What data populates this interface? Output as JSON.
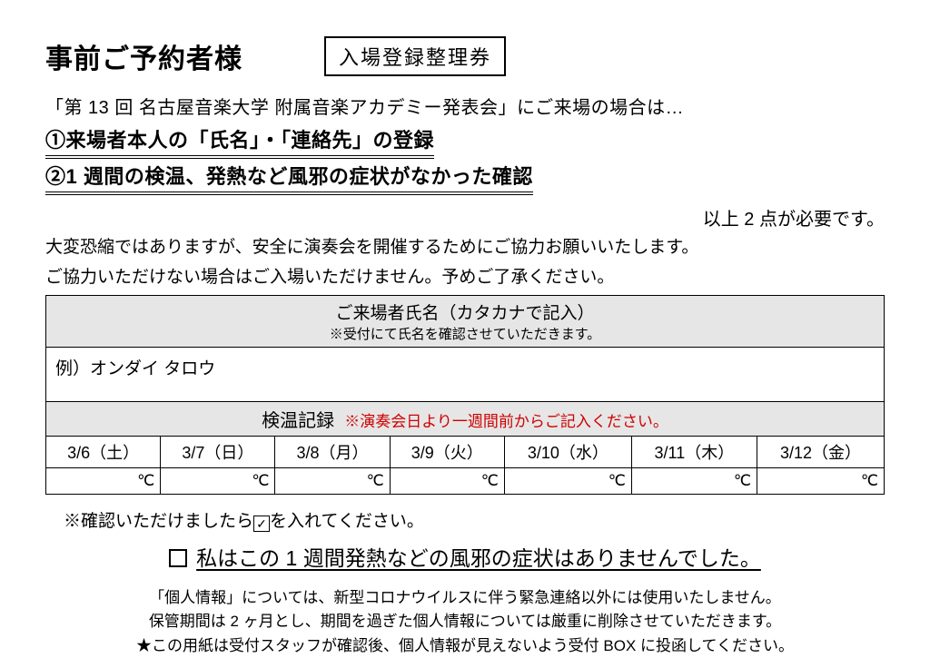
{
  "header": {
    "title": "事前ご予約者様",
    "ticket_label": "入場登録整理券"
  },
  "event_line": "「第 13 回  名古屋音楽大学  附属音楽アカデミー発表会」にご来場の場合は…",
  "req1": "①来場者本人の「氏名」・「連絡先」の登録",
  "req2": "②1 週間の検温、発熱など風邪の症状がなかった確認",
  "right_note": "以上 2 点が必要です。",
  "body1": "大変恐縮ではありますが、安全に演奏会を開催するためにご協力お願いいたします。",
  "body2": "ご協力いただけない場合はご入場いただけません。予めご了承ください。",
  "table": {
    "name_header": "ご来場者氏名（カタカナで記入）",
    "name_sub": "※受付にて氏名を確認させていただきます。",
    "name_example": "例）オンダイ  タロウ",
    "temp_header": "検温記録",
    "temp_note": "※演奏会日より一週間前からご記入ください。",
    "dates": [
      "3/6（土）",
      "3/7（日）",
      "3/8（月）",
      "3/9（火）",
      "3/10（水）",
      "3/11（木）",
      "3/12（金）"
    ],
    "unit": "℃"
  },
  "check_note_prefix": "※確認いただけましたら",
  "check_note_suffix": "を入れてください。",
  "check_mark": "✓",
  "declaration": "私はこの 1 週間発熱などの風邪の症状はありませんでした。",
  "footer1": "「個人情報」については、新型コロナウイルスに伴う緊急連絡以外には使用いたしません。",
  "footer2": "保管期間は 2 ヶ月とし、期間を過ぎた個人情報については厳重に削除させていただきます。",
  "footer3": "★この用紙は受付スタッフが確認後、個人情報が見えないよう受付 BOX に投函してください。"
}
